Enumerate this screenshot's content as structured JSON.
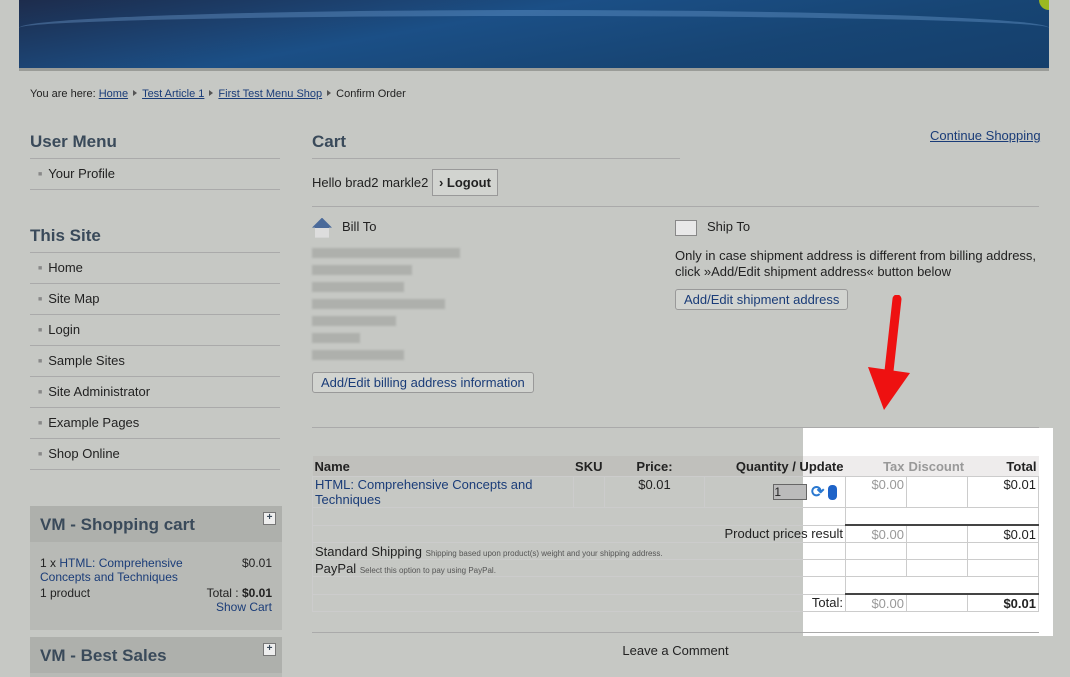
{
  "breadcrumb": {
    "prefix": "You are here:",
    "items": [
      "Home",
      "Test Article 1",
      "First Test Menu Shop"
    ],
    "current": "Confirm Order"
  },
  "user_menu": {
    "title": "User Menu",
    "items": [
      "Your Profile"
    ]
  },
  "this_site": {
    "title": "This Site",
    "items": [
      "Home",
      "Site Map",
      "Login",
      "Sample Sites",
      "Site Administrator",
      "Example Pages",
      "Shop Online"
    ]
  },
  "cart_module": {
    "title": "VM - Shopping cart",
    "qty": "1 x",
    "product": "HTML: Comprehensive Concepts and Techniques",
    "price": "$0.01",
    "count": "1 product",
    "total_label": "Total :",
    "total": "$0.01",
    "show_cart": "Show Cart"
  },
  "best_sales": {
    "title": "VM - Best Sales"
  },
  "main": {
    "title": "Cart",
    "continue": "Continue Shopping",
    "hello": "Hello brad2 markle2",
    "logout": "Logout",
    "bill_to": "Bill To",
    "bill_btn": "Add/Edit billing address information",
    "ship_to": "Ship To",
    "ship_text": "Only in case shipment address is different from billing address, click »Add/Edit shipment address« button below",
    "ship_btn": "Add/Edit shipment address"
  },
  "table": {
    "headers": [
      "Name",
      "SKU",
      "Price:",
      "Quantity / Update",
      "Tax",
      "Discount",
      "Total"
    ],
    "product": {
      "name": "HTML: Comprehensive Concepts and Techniques",
      "price": "$0.01",
      "qty": "1",
      "tax": "$0.00",
      "total": "$0.01"
    },
    "result": {
      "label": "Product prices result",
      "tax": "$0.00",
      "total": "$0.01"
    },
    "shipping": {
      "name": "Standard Shipping",
      "desc": "Shipping based upon product(s) weight and your shipping address."
    },
    "payment": {
      "name": "PayPal",
      "desc": "Select this option to pay using PayPal."
    },
    "grand": {
      "label": "Total:",
      "tax": "$0.00",
      "total": "$0.01"
    }
  },
  "footer": {
    "comment": "Leave a Comment"
  },
  "colors": {
    "annotation": "#ee1111",
    "link": "#1a3c78"
  }
}
